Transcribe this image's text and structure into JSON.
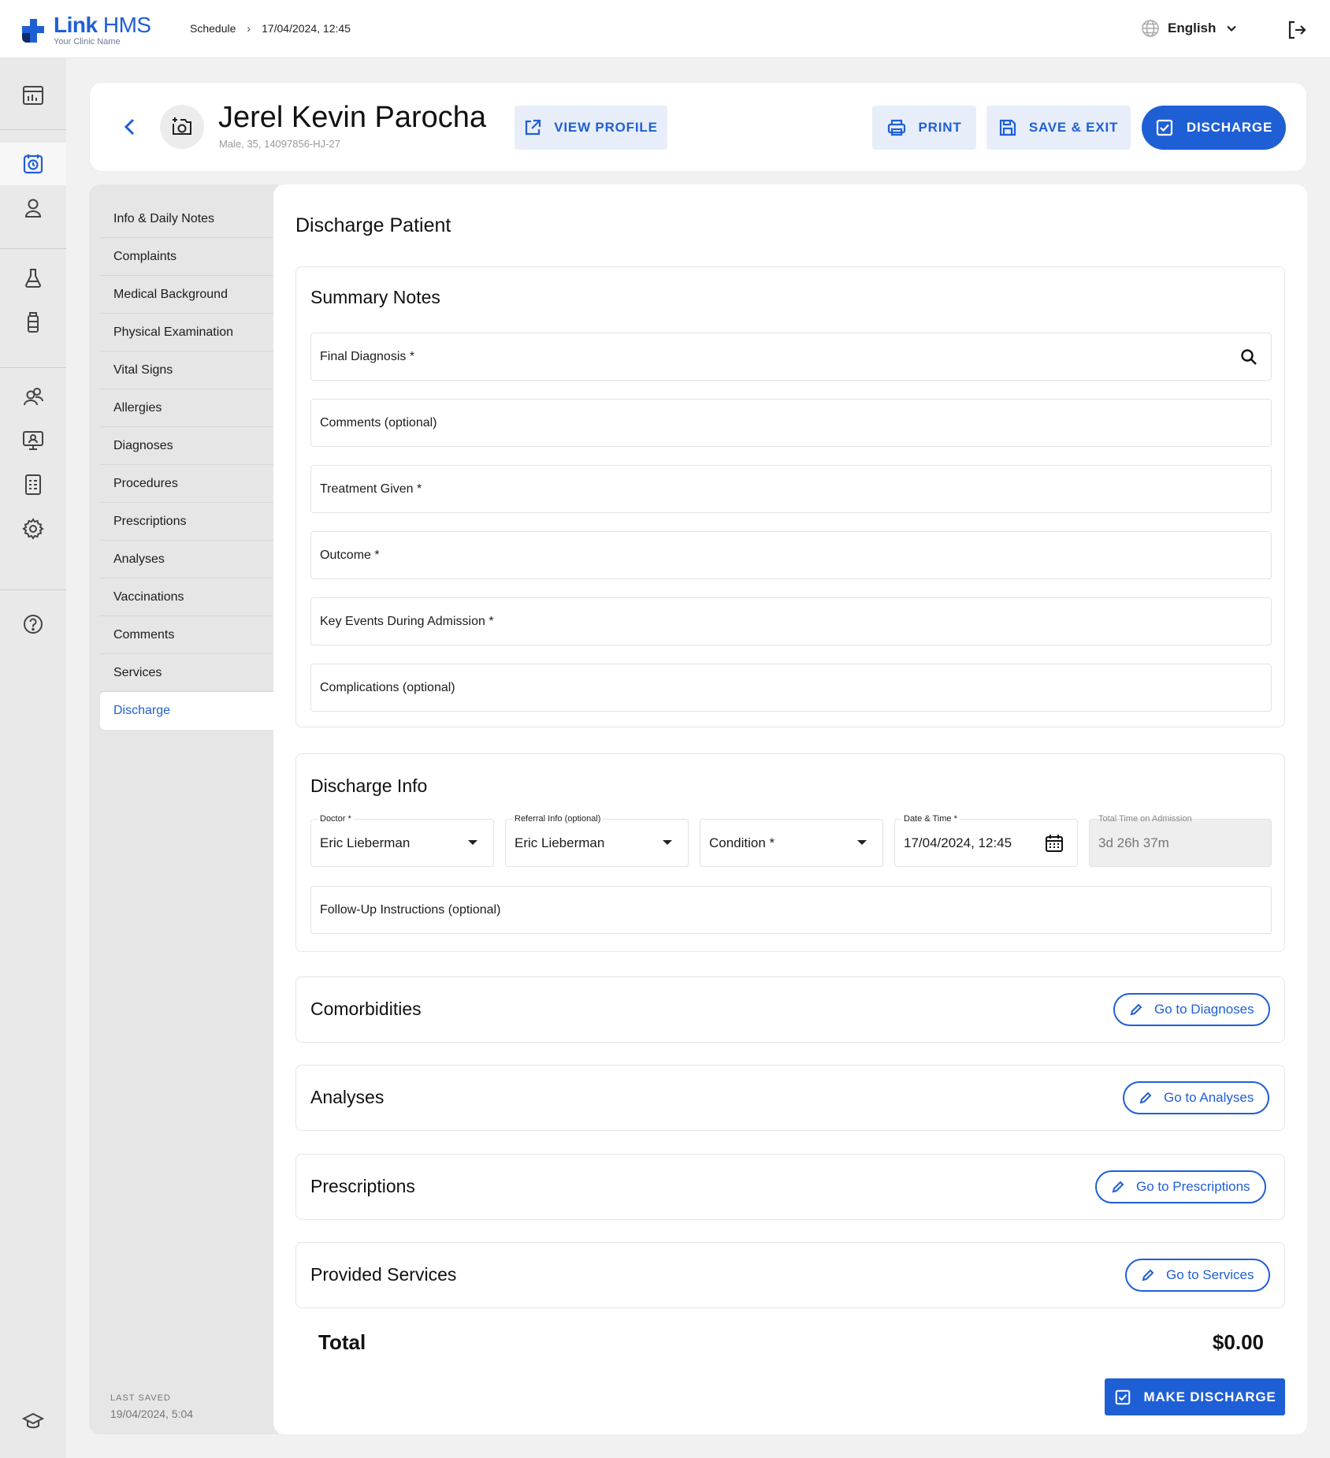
{
  "app": {
    "name_bold": "Link",
    "name_light": "HMS",
    "subtitle": "Your Clinic Name"
  },
  "breadcrumb": {
    "items": [
      "Schedule",
      "17/04/2024, 12:45"
    ],
    "separator": "›"
  },
  "language": {
    "selected": "English"
  },
  "icons": {
    "rail": [
      "dashboard-icon",
      "schedule-icon",
      "patient-icon",
      "lab-icon",
      "medicine-icon",
      "staff-icon",
      "monitor-icon",
      "report-icon",
      "settings-icon",
      "help-icon",
      "education-icon"
    ]
  },
  "header": {
    "patient_name": "Jerel Kevin Parocha",
    "patient_meta": "Male, 35, 14097856-HJ-27",
    "view_profile": "VIEW PROFILE",
    "print": "PRINT",
    "save_exit": "SAVE & EXIT",
    "discharge": "DISCHARGE"
  },
  "section_nav": {
    "items": [
      "Info & Daily Notes",
      "Complaints",
      "Medical Background",
      "Physical Examination",
      "Vital Signs",
      "Allergies",
      "Diagnoses",
      "Procedures",
      "Prescriptions",
      "Analyses",
      "Vaccinations",
      "Comments",
      "Services",
      "Discharge"
    ],
    "active": "Discharge",
    "last_saved_label": "LAST SAVED",
    "last_saved_value": "19/04/2024, 5:04"
  },
  "main": {
    "title": "Discharge Patient",
    "summary": {
      "title": "Summary Notes",
      "fields": [
        "Final Diagnosis *",
        "Comments (optional)",
        "Treatment Given *",
        "Outcome *",
        "Key Events During Admission *",
        "Complications (optional)"
      ]
    },
    "discharge_info": {
      "title": "Discharge Info",
      "doctor_label": "Doctor *",
      "doctor_value": "Eric Lieberman",
      "referral_label": "Referral Info (optional)",
      "referral_value": "Eric Lieberman",
      "condition_placeholder": "Condition *",
      "datetime_label": "Date & Time *",
      "datetime_value": "17/04/2024, 12:45",
      "total_time_label": "Total Time on Admission",
      "total_time_value": "3d 26h 37m",
      "followup_placeholder": "Follow-Up Instructions (optional)"
    },
    "comorbidities": {
      "title": "Comorbidities",
      "link": "Go to Diagnoses"
    },
    "analyses": {
      "title": "Analyses",
      "link": "Go to Analyses"
    },
    "prescriptions": {
      "title": "Prescriptions",
      "link": "Go to Prescriptions"
    },
    "services": {
      "title": "Provided Services",
      "link": "Go to Services"
    },
    "total_label": "Total",
    "total_value": "$0.00",
    "make_discharge": "MAKE DISCHARGE"
  },
  "colors": {
    "primary": "#1f5fd6",
    "light_button": "#e8eef9",
    "background": "#f1f1f1"
  }
}
